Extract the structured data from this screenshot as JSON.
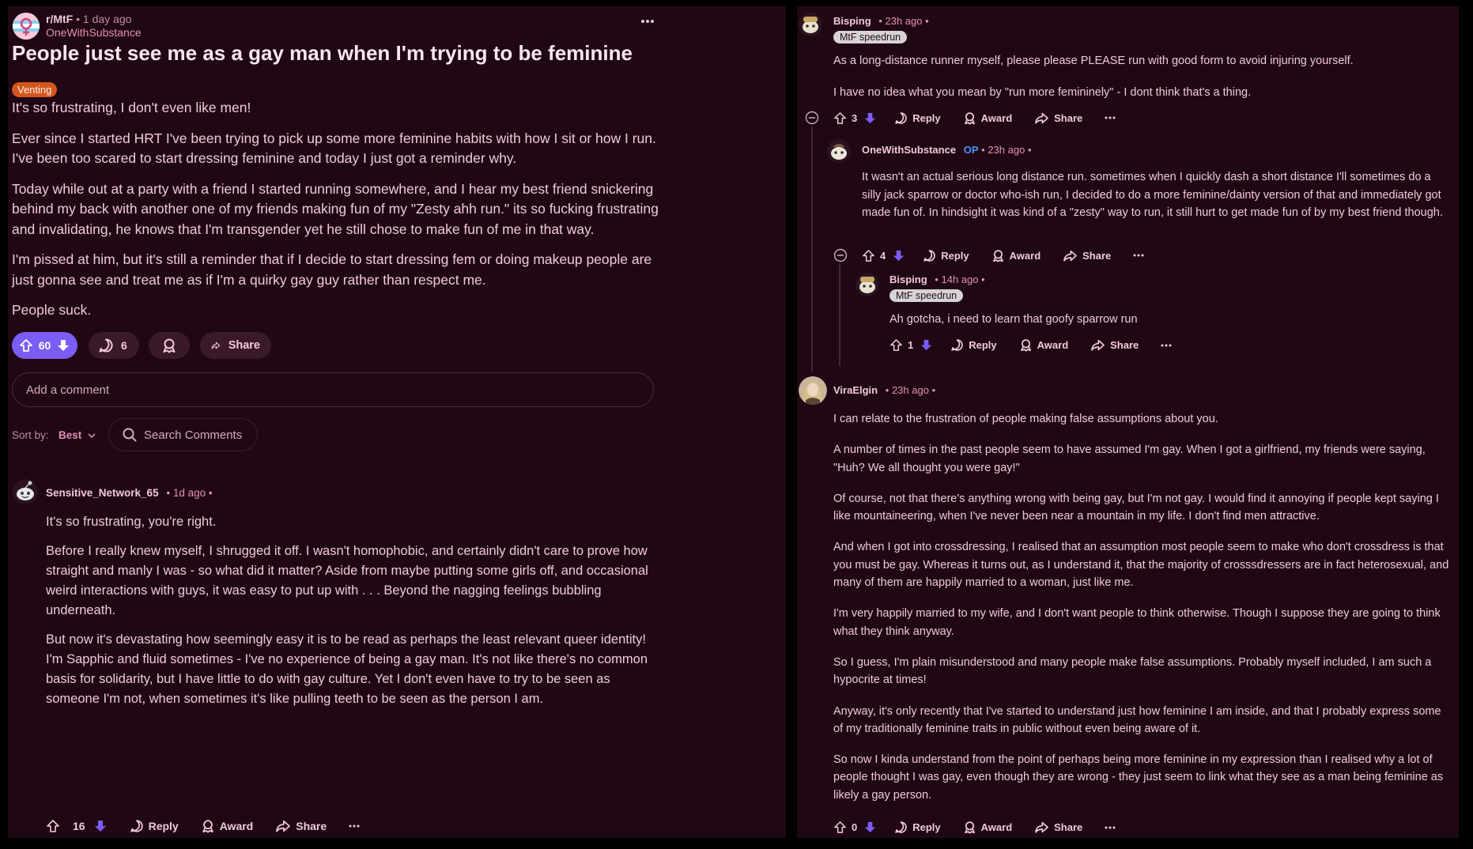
{
  "post": {
    "subreddit": "r/MtF",
    "time": "1 day ago",
    "author": "OneWithSubstance",
    "title": "People just see me as a gay man when I'm trying to be feminine",
    "flair": "Venting",
    "paragraphs": [
      "It's so frustrating, I don't even like men!",
      "Ever since I started HRT I've been trying to pick up some more feminine habits with how I sit or how I run. I've been too scared to start dressing feminine and today I just got a reminder why.",
      "Today while out at a party with a friend I started running somewhere, and I hear my best friend snickering behind my back with another one of my friends making fun of my \"Zesty ahh run.\" its so fucking frustrating and invalidating, he knows that I'm transgender yet he still chose to make fun of me in that way.",
      "I'm pissed at him, but it's still a reminder that if I decide to start dressing fem or doing makeup people are just gonna see and treat me as if I'm a quirky gay guy rather than respect me.",
      "People suck."
    ],
    "votes": "60",
    "comments": "6",
    "share_label": "Share",
    "more_icon": "ellipsis-icon"
  },
  "comment_box": {
    "placeholder": "Add a comment"
  },
  "sort": {
    "label": "Sort by:",
    "value": "Best",
    "search_placeholder": "Search Comments"
  },
  "comments": [
    {
      "author": "Sensitive_Network_65",
      "time": "1d ago",
      "paragraphs": [
        "It's so frustrating, you're right.",
        "Before I really knew myself, I shrugged it off. I wasn't homophobic, and certainly didn't care to prove how straight and manly I was - so what did it matter? Aside from maybe putting some girls off, and occasional weird interactions with guys, it was easy to put up with . . . Beyond the nagging feelings bubbling underneath.",
        "But now it's devastating how seemingly easy it is to be read as perhaps the least relevant queer identity! I'm Sapphic and fluid sometimes - I've no experience of being a gay man. It's not like there's no common basis for solidarity, but I have little to do with gay culture. Yet I don't even have to try to be seen as someone I'm not, when sometimes it's like pulling teeth to be seen as the person I am."
      ],
      "votes": "16"
    },
    {
      "author": "Bisping",
      "time": "23h ago",
      "flair": "MtF speedrun",
      "paragraphs": [
        "As a long-distance runner myself, please please PLEASE run with good form to avoid injuring yourself.",
        "I have no idea what you mean by \"run more femininely\" - I dont think that's a thing."
      ],
      "votes": "3"
    },
    {
      "author": "OneWithSubstance",
      "op": "OP",
      "time": "23h ago",
      "paragraphs": [
        "It wasn't an actual serious long distance run. sometimes when I quickly dash a short distance I'll sometimes do a silly jack sparrow or doctor who-ish run, I decided to do a more feminine/dainty version of that and immediately got made fun of. In hindsight it was kind of a \"zesty\" way to run, it still hurt to get made fun of by my best friend though."
      ],
      "votes": "4"
    },
    {
      "author": "Bisping",
      "time": "14h ago",
      "flair": "MtF speedrun",
      "paragraphs": [
        "Ah gotcha, i need to learn that goofy sparrow run"
      ],
      "votes": "1"
    },
    {
      "author": "ViraElgin",
      "time": "23h ago",
      "paragraphs": [
        "I can relate to the frustration of people making false assumptions about you.",
        "A number of times in the past people seem to have assumed I'm gay. When I got a girlfriend, my friends were saying, \"Huh? We all thought you were gay!\"",
        "Of course, not that there's anything wrong with being gay, but I'm not gay. I would find it annoying if people kept saying I like mountaineering, when I've never been near a mountain in my life. I don't find men attractive.",
        "And when I got into crossdressing, I realised that an assumption most people seem to make who don't crossdress is that you must be gay. Whereas it turns out, as I understand it, that the majority of crosssdressers are in fact heterosexual, and many of them are happily married to a woman, just like me.",
        "I'm very happily married to my wife, and I don't want people to think otherwise. Though I suppose they are going to think what they think anyway.",
        "So I guess, I'm plain misunderstood and many people make false assumptions. Probably myself included, I am such a hypocrite at times!",
        "Anyway, it's only recently that I've started to understand just how feminine I am inside, and that I probably express some of my traditionally feminine traits in public without even being aware of it.",
        "So now I kinda understand from the point of perhaps being more feminine in my expression than I realised why a lot of people thought I was gay, even though they are wrong - they just seem to link what they see as a man being feminine as likely a gay person."
      ],
      "votes": "0"
    }
  ],
  "actions": {
    "reply": "Reply",
    "award": "Award",
    "share": "Share"
  },
  "separators": {
    "dot": "•"
  },
  "colors": {
    "background": "#1f0814",
    "upvote_pill": "#7b5cf5",
    "downvote": "#7b5cf5",
    "flair_venting": "#d4561c",
    "accent_text": "#e58fb8"
  }
}
